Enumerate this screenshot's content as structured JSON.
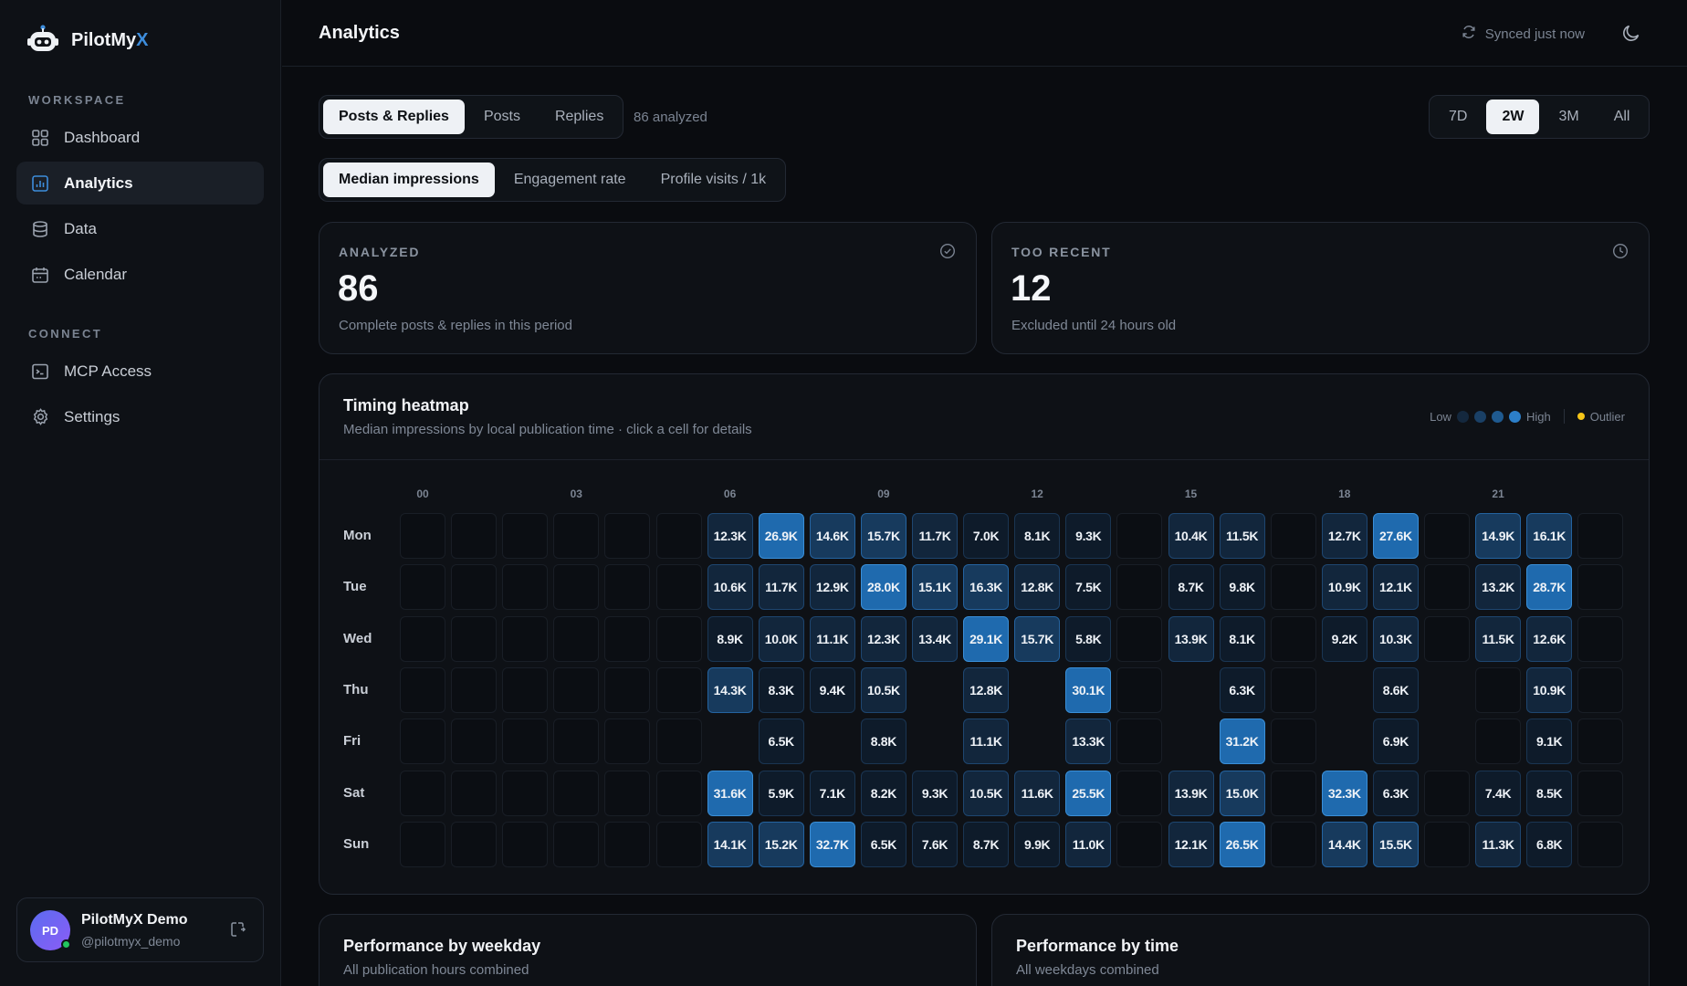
{
  "app": {
    "brand_prefix": "PilotMy",
    "brand_suffix": "X"
  },
  "sidebar": {
    "workspace_label": "WORKSPACE",
    "connect_label": "CONNECT",
    "items": [
      {
        "label": "Dashboard",
        "icon": "grid-icon"
      },
      {
        "label": "Analytics",
        "icon": "chart-icon"
      },
      {
        "label": "Data",
        "icon": "database-icon"
      },
      {
        "label": "Calendar",
        "icon": "calendar-icon"
      },
      {
        "label": "MCP Access",
        "icon": "terminal-icon"
      },
      {
        "label": "Settings",
        "icon": "gear-icon"
      }
    ],
    "user": {
      "initials": "PD",
      "name": "PilotMyX Demo",
      "handle": "@pilotmyx_demo"
    }
  },
  "header": {
    "title": "Analytics",
    "sync_status": "Synced just now"
  },
  "filters": {
    "content_tabs": [
      "Posts & Replies",
      "Posts",
      "Replies"
    ],
    "content_selected": "Posts & Replies",
    "analyzed_text": "86 analyzed",
    "metric_tabs": [
      "Median impressions",
      "Engagement rate",
      "Profile visits / 1k"
    ],
    "metric_selected": "Median impressions",
    "range_tabs": [
      "7D",
      "2W",
      "3M",
      "All"
    ],
    "range_selected": "2W"
  },
  "stats": {
    "analyzed": {
      "label": "ANALYZED",
      "value": "86",
      "sub": "Complete posts & replies in this period"
    },
    "too_recent": {
      "label": "TOO RECENT",
      "value": "12",
      "sub": "Excluded until 24 hours old"
    }
  },
  "heatmap": {
    "title": "Timing heatmap",
    "subtitle": "Median impressions by local publication time · click a cell for details",
    "legend_low": "Low",
    "legend_high": "High",
    "legend_outlier": "Outlier",
    "hour_labels": [
      "00",
      "03",
      "06",
      "09",
      "12",
      "15",
      "18",
      "21"
    ],
    "days": [
      "Mon",
      "Tue",
      "Wed",
      "Thu",
      "Fri",
      "Sat",
      "Sun"
    ],
    "cells": [
      [
        "",
        "",
        "",
        "",
        "",
        "",
        "12.3K",
        "26.9K",
        "14.6K",
        "15.7K",
        "11.7K",
        "7.0K",
        "8.1K",
        "9.3K",
        "",
        "10.4K",
        "11.5K",
        "",
        "12.7K",
        "27.6K",
        "",
        "14.9K",
        "16.1K",
        ""
      ],
      [
        "",
        "",
        "",
        "",
        "",
        "",
        "10.6K",
        "11.7K",
        "12.9K",
        "28.0K",
        "15.1K",
        "16.3K",
        "12.8K",
        "7.5K",
        "",
        "8.7K",
        "9.8K",
        "",
        "10.9K",
        "12.1K",
        "",
        "13.2K",
        "28.7K",
        ""
      ],
      [
        "",
        "",
        "",
        "",
        "",
        "",
        "8.9K",
        "10.0K",
        "11.1K",
        "12.3K",
        "13.4K",
        "29.1K",
        "15.7K",
        "5.8K",
        "",
        "13.9K",
        "8.1K",
        "",
        "9.2K",
        "10.3K",
        "",
        "11.5K",
        "12.6K",
        ""
      ],
      [
        "",
        "",
        "",
        "",
        "",
        "",
        "14.3K",
        "8.3K",
        "9.4K",
        "10.5K",
        "_",
        "12.8K",
        "_",
        "30.1K",
        "",
        "_",
        "6.3K",
        "",
        "_",
        "8.6K",
        "_",
        "",
        "10.9K",
        ""
      ],
      [
        "",
        "",
        "",
        "",
        "",
        "",
        "_",
        "6.5K",
        "_",
        "8.8K",
        "_",
        "11.1K",
        "_",
        "13.3K",
        "",
        "_",
        "31.2K",
        "",
        "_",
        "6.9K",
        "_",
        "",
        "9.1K",
        ""
      ],
      [
        "",
        "",
        "",
        "",
        "",
        "",
        "31.6K",
        "5.9K",
        "7.1K",
        "8.2K",
        "9.3K",
        "10.5K",
        "11.6K",
        "25.5K",
        "",
        "13.9K",
        "15.0K",
        "",
        "32.3K",
        "6.3K",
        "",
        "7.4K",
        "8.5K",
        ""
      ],
      [
        "",
        "",
        "",
        "",
        "",
        "",
        "14.1K",
        "15.2K",
        "32.7K",
        "6.5K",
        "7.6K",
        "8.7K",
        "9.9K",
        "11.0K",
        "",
        "12.1K",
        "26.5K",
        "",
        "14.4K",
        "15.5K",
        "",
        "11.3K",
        "6.8K",
        ""
      ]
    ]
  },
  "sections": {
    "weekday": {
      "title": "Performance by weekday",
      "sub": "All publication hours combined"
    },
    "time": {
      "title": "Performance by time",
      "sub": "All weekdays combined"
    }
  }
}
